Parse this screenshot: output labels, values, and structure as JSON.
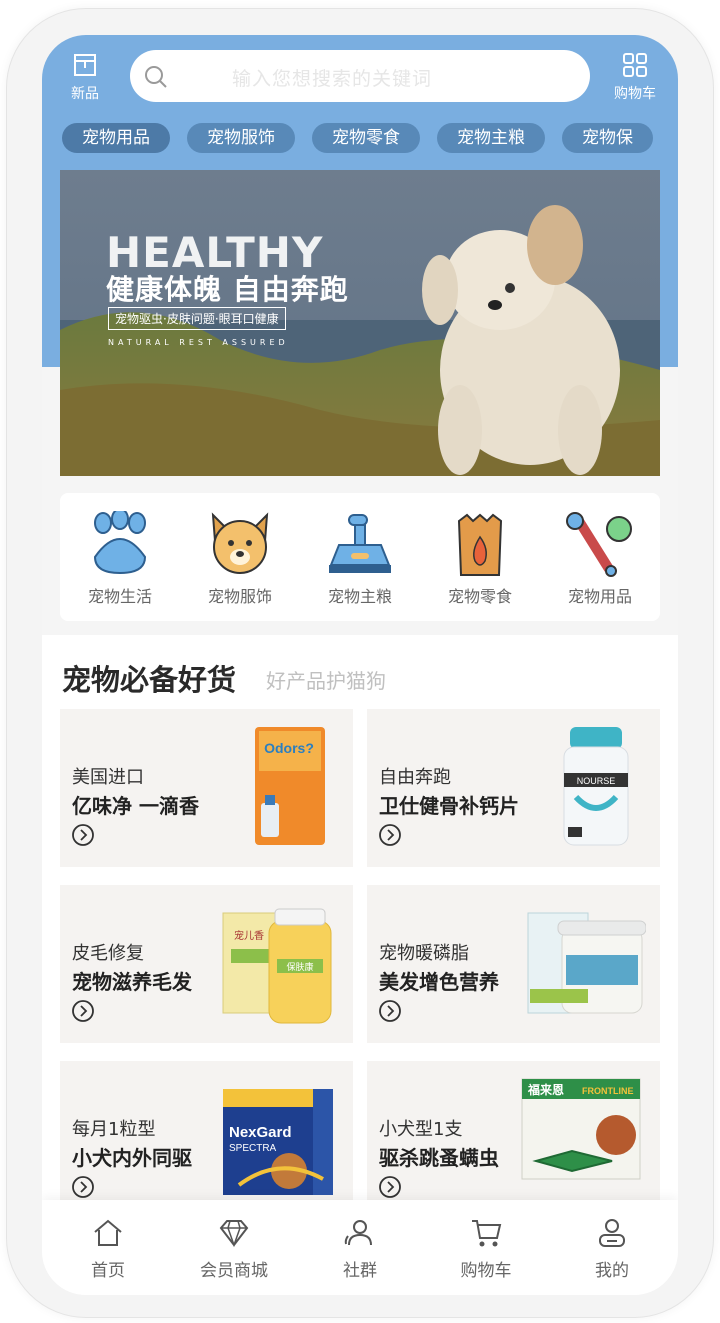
{
  "header": {
    "new_label": "新品",
    "cart_label": "购物车",
    "search_placeholder": "输入您想搜索的关键词"
  },
  "categories": [
    "宠物用品",
    "宠物服饰",
    "宠物零食",
    "宠物主粮",
    "宠物保"
  ],
  "banner": {
    "title_en": "HEALTHY",
    "title_cn": "健康体魄 自由奔跑",
    "tagline": "宠物驱虫·皮肤问题·眼耳口健康",
    "footer": "NATURAL REST ASSURED"
  },
  "quick_links": [
    "宠物生活",
    "宠物服饰",
    "宠物主粮",
    "宠物零食",
    "宠物用品"
  ],
  "section": {
    "title": "宠物必备好货",
    "subtitle": "好产品护猫狗"
  },
  "products": [
    {
      "line1": "美国进口",
      "line2": "亿味净 一滴香"
    },
    {
      "line1": "自由奔跑",
      "line2": "卫仕健骨补钙片"
    },
    {
      "line1": "皮毛修复",
      "line2": "宠物滋养毛发"
    },
    {
      "line1": "宠物暖磷脂",
      "line2": "美发增色营养"
    },
    {
      "line1": "每月1粒型",
      "line2": "小犬内外同驱"
    },
    {
      "line1": "小犬型1支",
      "line2": "驱杀跳蚤螨虫"
    }
  ],
  "product_labels": {
    "odors": "Odors?",
    "nourse": "NOURSE",
    "chongersheng": "宠儿香",
    "brand_label": "保肤康",
    "nexgard": "NexGard",
    "spectra": "SPECTRA",
    "frontline": "FRONTLINE",
    "fulaien": "福来恩"
  },
  "tabs": [
    "首页",
    "会员商城",
    "社群",
    "购物车",
    "我的"
  ],
  "colors": {
    "header_blue": "#7aaee0",
    "chip": "#5889b8",
    "icon_blue": "#6fb1e6"
  }
}
